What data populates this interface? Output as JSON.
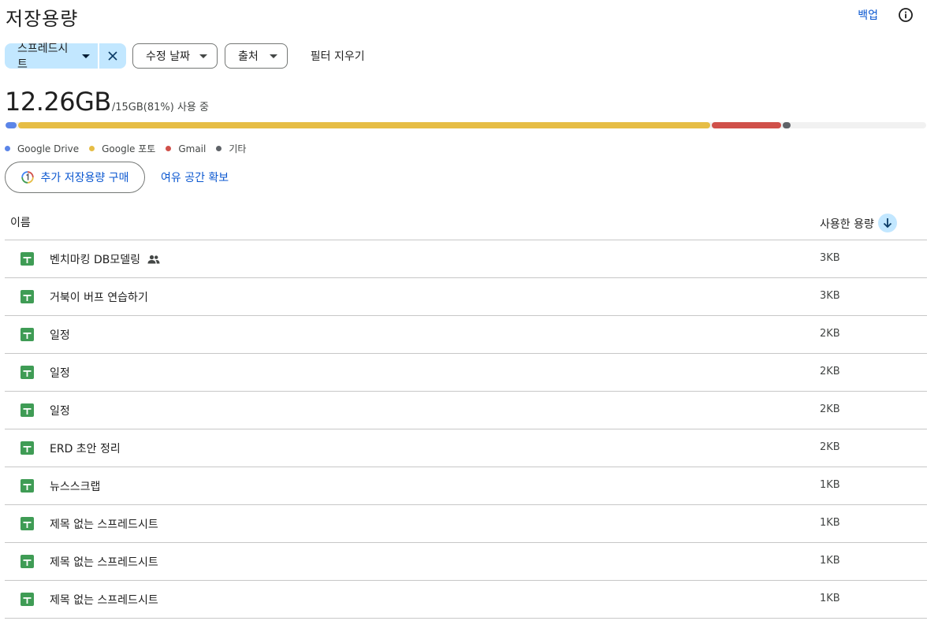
{
  "header": {
    "title": "저장용량",
    "backup_label": "백업",
    "info_icon": "info-icon"
  },
  "filters": {
    "type_chip": "스프레드시트",
    "modified_chip": "수정 날짜",
    "source_chip": "출처",
    "clear_label": "필터 지우기"
  },
  "usage": {
    "used": "12.26GB",
    "detail": "/15GB(81%) 사용 중",
    "percent_used": 81,
    "segments": [
      {
        "name": "Google Drive",
        "color": "#5b85e8",
        "gb": 0.2
      },
      {
        "name": "Google 포토",
        "color": "#e6bd45",
        "gb": 11.3
      },
      {
        "name": "Gmail",
        "color": "#d0504a",
        "gb": 1.15
      },
      {
        "name": "기타",
        "color": "#5f6368",
        "gb": 0.15
      }
    ],
    "total_gb": 15
  },
  "legend": [
    {
      "label": "Google Drive",
      "color": "#5b85e8"
    },
    {
      "label": "Google 포토",
      "color": "#e6bd45"
    },
    {
      "label": "Gmail",
      "color": "#d0504a"
    },
    {
      "label": "기타",
      "color": "#5f6368"
    }
  ],
  "actions": {
    "buy_label": "추가 저장용량 구매",
    "free_space_label": "여유 공간 확보"
  },
  "table": {
    "col_name": "이름",
    "col_size": "사용한 용량",
    "rows": [
      {
        "name": "벤치마킹 DB모델링",
        "size": "3KB",
        "shared": true
      },
      {
        "name": "거북이 버프 연습하기",
        "size": "3KB",
        "shared": false
      },
      {
        "name": "일정",
        "size": "2KB",
        "shared": false
      },
      {
        "name": "일정",
        "size": "2KB",
        "shared": false
      },
      {
        "name": "일정",
        "size": "2KB",
        "shared": false
      },
      {
        "name": "ERD 초안 정리",
        "size": "2KB",
        "shared": false
      },
      {
        "name": "뉴스스크랩",
        "size": "1KB",
        "shared": false
      },
      {
        "name": "제목 없는 스프레드시트",
        "size": "1KB",
        "shared": false
      },
      {
        "name": "제목 없는 스프레드시트",
        "size": "1KB",
        "shared": false
      },
      {
        "name": "제목 없는 스프레드시트",
        "size": "1KB",
        "shared": false
      }
    ]
  }
}
